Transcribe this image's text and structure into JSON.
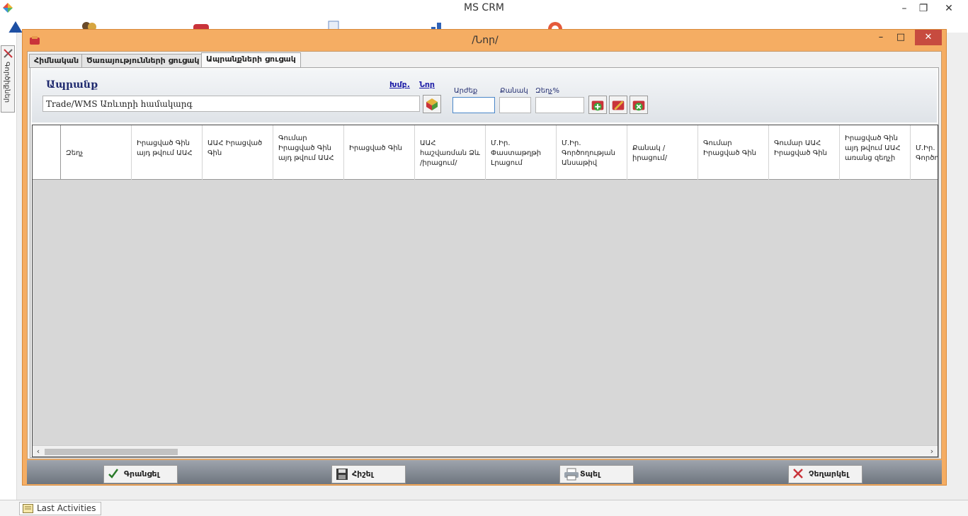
{
  "app": {
    "title": "MS CRM",
    "menu_icons": [
      "home-pyramid-icon",
      "users-icon",
      "car-icon",
      "documents-icon",
      "chart-icon",
      "lifebuoy-icon"
    ]
  },
  "side_tab": {
    "label": "Գործիքներ"
  },
  "status_bar": {
    "last_activities_label": "Last Activities"
  },
  "dialog": {
    "title": "/Նոր/",
    "tabs": [
      {
        "label": "Հիմնական",
        "active": false
      },
      {
        "label": "Ծառայությունների ցուցակ",
        "active": false
      },
      {
        "label": "Ապրանքների ցուցակ",
        "active": true
      }
    ],
    "form": {
      "product_label": "Ապրանք",
      "edit_link": "Խմբ.",
      "new_link": "Նոր",
      "product_value": "Trade/WMS Առևտրի համակարգ",
      "value_label": "Արժեք",
      "value_input": "",
      "quantity_label": "Քանակ",
      "quantity_input": "",
      "discount_label": "Զեղչ%",
      "discount_input": ""
    },
    "grid": {
      "columns": [
        "Զեղչ",
        "Իրացված Գին այդ թվում ԱԱՀ",
        "ԱԱՀ Իրացված Գին",
        "Գումար Իրացված Գին այդ թվում ԱԱՀ",
        "Իրացված Գին",
        "ԱԱՀ հաշվառման Ձև /իրացում/",
        "Մ.Իր. Փաստաթղթի Լրացում",
        "Մ.Իր. Գործողության Անսաթիվ",
        "Քանակ /իրացում/",
        "Գումար Իրացված Գին",
        "Գումար ԱԱՀ Իրացված Գին",
        "Իրացված Գին այդ թվում ԱԱՀ առանց զեղչի",
        "Մ.Իր. Գործողության"
      ]
    },
    "footer": {
      "confirm_label": "Գրանցել",
      "save_label": "Հիշել",
      "print_label": "Տպել",
      "cancel_label": "Չեղարկել"
    }
  }
}
